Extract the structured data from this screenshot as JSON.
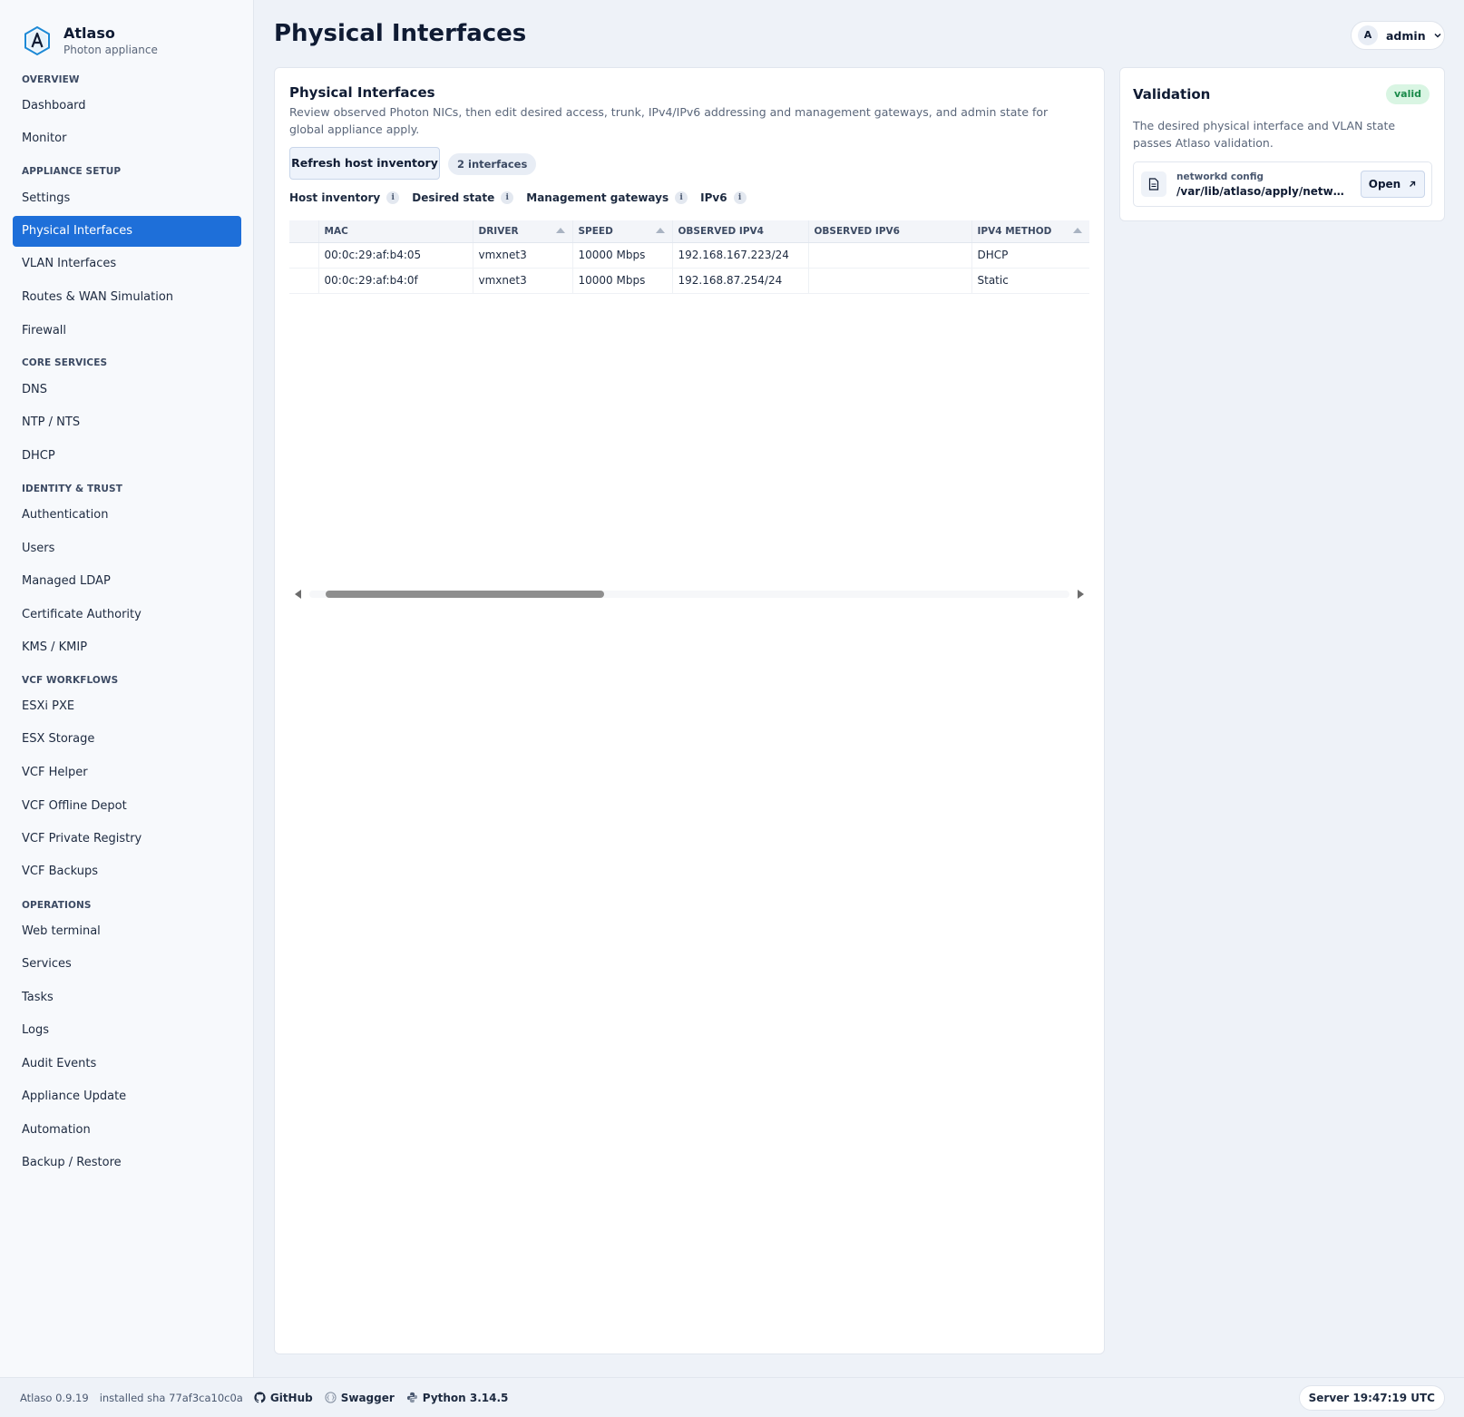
{
  "brand": {
    "name": "Atlaso",
    "subtitle": "Photon appliance"
  },
  "sidebar": {
    "sections": [
      {
        "label": "OVERVIEW",
        "items": [
          "Dashboard",
          "Monitor"
        ]
      },
      {
        "label": "APPLIANCE SETUP",
        "items": [
          "Settings",
          "Physical Interfaces",
          "VLAN Interfaces",
          "Routes & WAN Simulation",
          "Firewall"
        ]
      },
      {
        "label": "CORE SERVICES",
        "items": [
          "DNS",
          "NTP / NTS",
          "DHCP"
        ]
      },
      {
        "label": "IDENTITY & TRUST",
        "items": [
          "Authentication",
          "Users",
          "Managed LDAP",
          "Certificate Authority",
          "KMS / KMIP"
        ]
      },
      {
        "label": "VCF WORKFLOWS",
        "items": [
          "ESXi PXE",
          "ESX Storage",
          "VCF Helper",
          "VCF Offline Depot",
          "VCF Private Registry",
          "VCF Backups"
        ]
      },
      {
        "label": "OPERATIONS",
        "items": [
          "Web terminal",
          "Services",
          "Tasks",
          "Logs",
          "Audit Events",
          "Appliance Update",
          "Automation",
          "Backup / Restore"
        ]
      }
    ],
    "active_item": "Physical Interfaces"
  },
  "header": {
    "title": "Physical Interfaces",
    "user": {
      "initial": "A",
      "name": "admin"
    }
  },
  "main": {
    "title": "Physical Interfaces",
    "description": "Review observed Photon NICs, then edit desired access, trunk, IPv4/IPv6 addressing and management gateways, and admin state for global appliance apply.",
    "refresh_label": "Refresh host inventory",
    "count_label": "2 interfaces",
    "legend": [
      "Host inventory",
      "Desired state",
      "Management gateways",
      "IPv6"
    ],
    "info_glyph": "i",
    "table": {
      "columns": [
        "",
        "MAC",
        "DRIVER",
        "SPEED",
        "OBSERVED IPV4",
        "OBSERVED IPV6",
        "IPV4 METHOD"
      ],
      "rows": [
        [
          "",
          "00:0c:29:af:b4:05",
          "vmxnet3",
          "10000 Mbps",
          "192.168.167.223/24",
          "",
          "DHCP"
        ],
        [
          "",
          "00:0c:29:af:b4:0f",
          "vmxnet3",
          "10000 Mbps",
          "192.168.87.254/24",
          "",
          "Static"
        ]
      ]
    }
  },
  "validation": {
    "title": "Validation",
    "badge": "valid",
    "description": "The desired physical interface and VLAN state passes Atlaso validation.",
    "file_label": "networkd config",
    "file_path": "/var/lib/atlaso/apply/network/...",
    "open_label": "Open"
  },
  "footer": {
    "version": "Atlaso 0.9.19",
    "sha": "installed sha 77af3ca10c0a",
    "github": "GitHub",
    "swagger": "Swagger",
    "python": "Python 3.14.5",
    "server_time": "Server 19:47:19 UTC"
  },
  "colors": {
    "accent": "#1e6fd9",
    "valid_bg": "#d9f5e3",
    "valid_text": "#1a8a4a"
  }
}
